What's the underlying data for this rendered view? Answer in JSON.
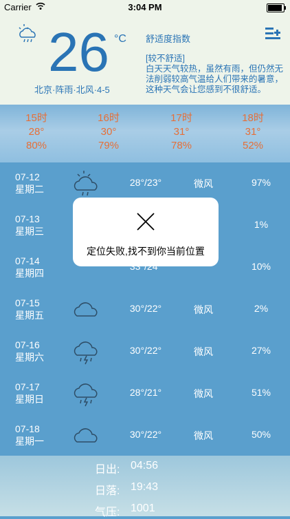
{
  "status": {
    "carrier": "Carrier",
    "time": "3:04 PM"
  },
  "current": {
    "temp": "26",
    "unit": "°C",
    "location": "北京·阵雨·北风·4-5",
    "icon": "cloud-rain-icon"
  },
  "comfort": {
    "title": "舒适度指数",
    "level": "[较不舒适]",
    "text": "白天天气较热，虽然有雨，但仍然无法削弱较高气温给人们带来的暑意，这种天气会让您感到不很舒适。"
  },
  "hourly": [
    {
      "time": "15时",
      "temp": "28°",
      "pct": "80%"
    },
    {
      "time": "16时",
      "temp": "30°",
      "pct": "79%"
    },
    {
      "time": "17时",
      "temp": "31°",
      "pct": "78%"
    },
    {
      "time": "18时",
      "temp": "31°",
      "pct": "52%"
    }
  ],
  "daily": [
    {
      "date": "07-12",
      "day": "星期二",
      "icon": "partly-cloudy-rain-icon",
      "range": "28°/23°",
      "wind": "微风",
      "pct": "97%"
    },
    {
      "date": "07-13",
      "day": "星期三",
      "icon": "cloud-icon",
      "range": "",
      "wind": "",
      "pct": "1%"
    },
    {
      "date": "07-14",
      "day": "星期四",
      "icon": "cloud-icon",
      "range": "33°/24°",
      "wind": "",
      "pct": "10%"
    },
    {
      "date": "07-15",
      "day": "星期五",
      "icon": "cloud-icon",
      "range": "30°/22°",
      "wind": "微风",
      "pct": "2%"
    },
    {
      "date": "07-16",
      "day": "星期六",
      "icon": "thunderstorm-icon",
      "range": "30°/22°",
      "wind": "微风",
      "pct": "27%"
    },
    {
      "date": "07-17",
      "day": "星期日",
      "icon": "thunderstorm-icon",
      "range": "28°/21°",
      "wind": "微风",
      "pct": "51%"
    },
    {
      "date": "07-18",
      "day": "星期一",
      "icon": "cloud-icon",
      "range": "30°/22°",
      "wind": "微风",
      "pct": "50%"
    }
  ],
  "footer": [
    {
      "label": "日出:",
      "value": "04:56"
    },
    {
      "label": "日落:",
      "value": "19:43"
    },
    {
      "label": "气压:",
      "value": "1001"
    }
  ],
  "dialog": {
    "message": "定位失败,找不到你当前位置",
    "icon": "close-icon"
  },
  "colors": {
    "accent": "#2a74b5",
    "hourly_text": "#e56f38",
    "list_bg": "#5a9fcd",
    "header_bg": "#eef4ea"
  }
}
